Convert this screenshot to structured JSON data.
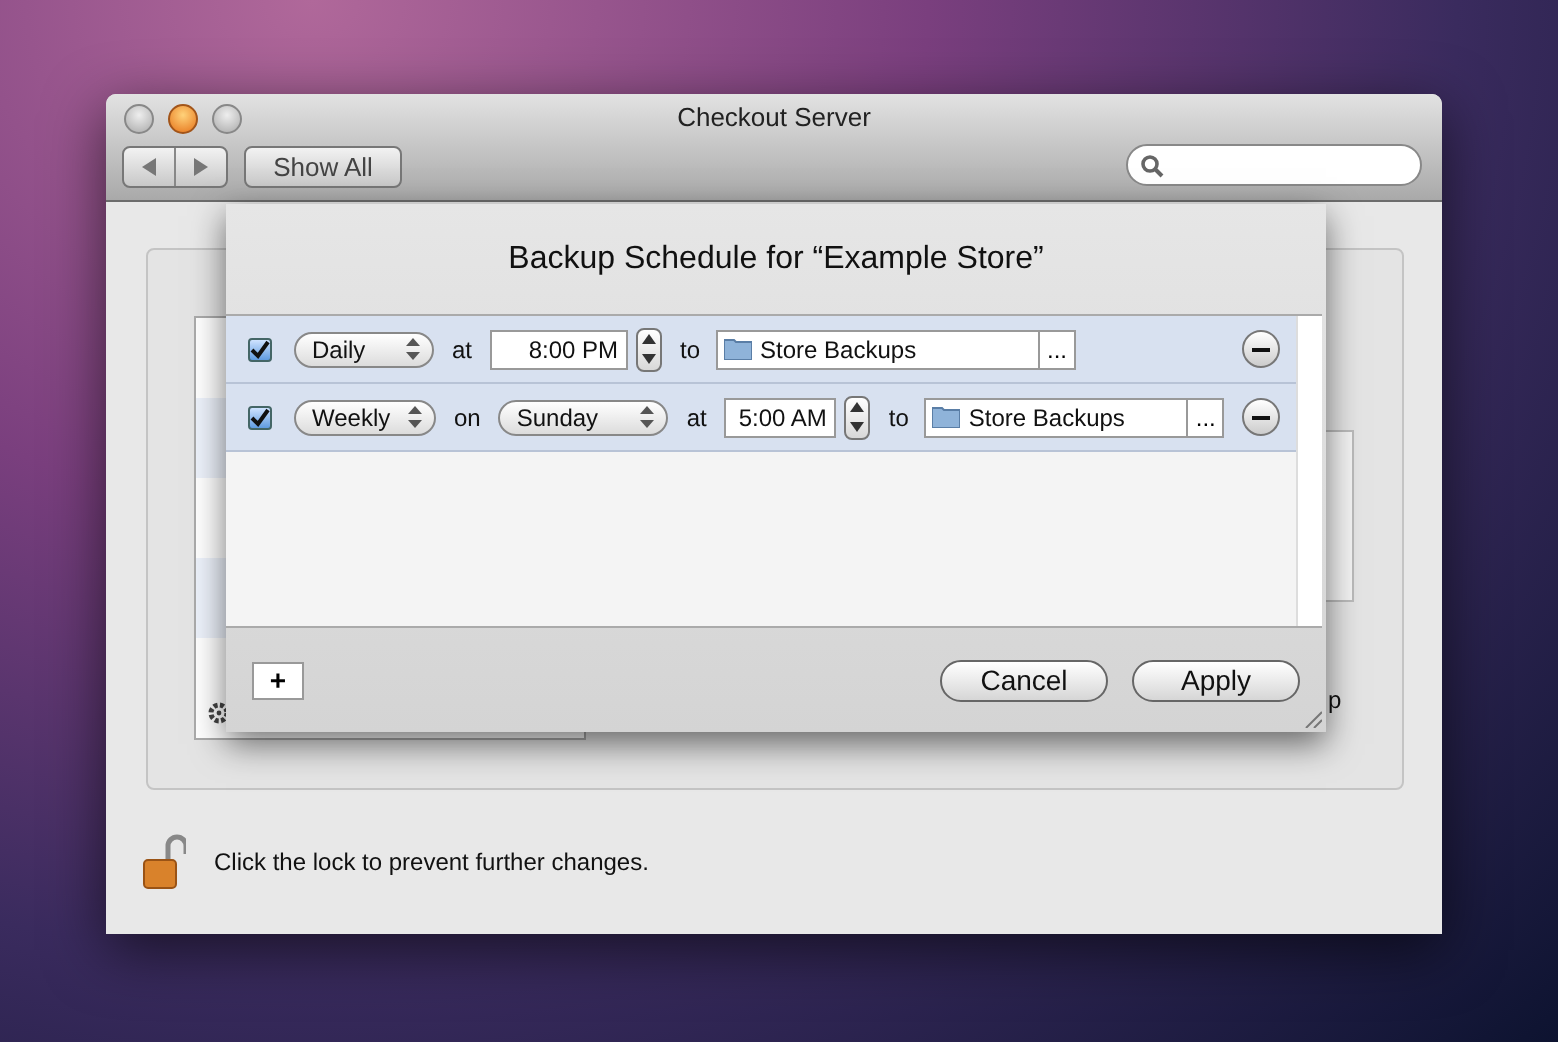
{
  "window": {
    "title": "Checkout Server",
    "show_all": "Show All"
  },
  "background_fragment": "p",
  "sheet": {
    "title": "Backup Schedule for “Example Store”",
    "rows": [
      {
        "kind": "daily",
        "checked": true,
        "frequency": "Daily",
        "time_label": "at",
        "time": "8:00 PM",
        "to_label": "to",
        "destination": "Store Backups",
        "browse": "..."
      },
      {
        "kind": "weekly",
        "checked": true,
        "frequency": "Weekly",
        "day_label": "on",
        "day": "Sunday",
        "time_label": "at",
        "time": "5:00 AM",
        "to_label": "to",
        "destination": "Store Backups",
        "browse": "..."
      }
    ],
    "add_button": "+",
    "buttons": [
      "Cancel",
      "Apply"
    ]
  },
  "lock": {
    "locked": false,
    "message": "Click the lock to prevent further changes."
  }
}
